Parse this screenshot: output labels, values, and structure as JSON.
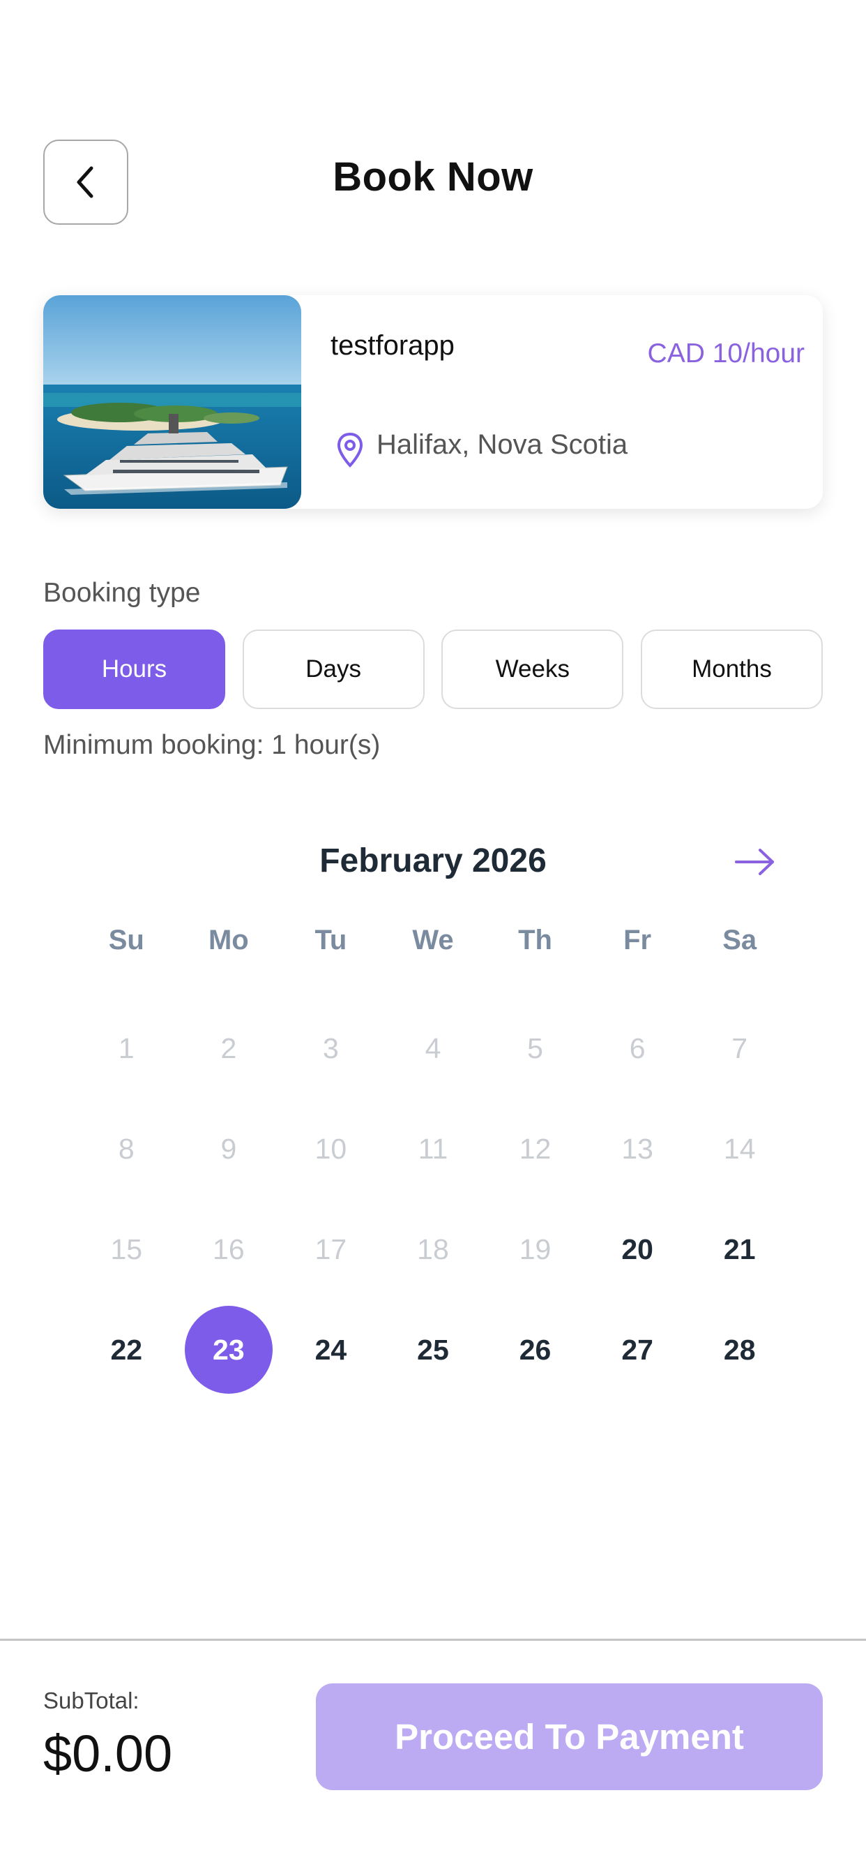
{
  "header": {
    "title": "Book Now"
  },
  "listing": {
    "name": "testforapp",
    "price": "CAD 10/hour",
    "location": "Halifax, Nova Scotia"
  },
  "booking": {
    "label": "Booking type",
    "types": [
      "Hours",
      "Days",
      "Weeks",
      "Months"
    ],
    "selected_type": "Hours",
    "minimum_text": "Minimum booking: 1 hour(s)"
  },
  "calendar": {
    "month_label": "February 2026",
    "weekdays": [
      "Su",
      "Mo",
      "Tu",
      "We",
      "Th",
      "Fr",
      "Sa"
    ],
    "days": [
      {
        "d": "1",
        "state": "disabled"
      },
      {
        "d": "2",
        "state": "disabled"
      },
      {
        "d": "3",
        "state": "disabled"
      },
      {
        "d": "4",
        "state": "disabled"
      },
      {
        "d": "5",
        "state": "disabled"
      },
      {
        "d": "6",
        "state": "disabled"
      },
      {
        "d": "7",
        "state": "disabled"
      },
      {
        "d": "8",
        "state": "disabled"
      },
      {
        "d": "9",
        "state": "disabled"
      },
      {
        "d": "10",
        "state": "disabled"
      },
      {
        "d": "11",
        "state": "disabled"
      },
      {
        "d": "12",
        "state": "disabled"
      },
      {
        "d": "13",
        "state": "disabled"
      },
      {
        "d": "14",
        "state": "disabled"
      },
      {
        "d": "15",
        "state": "disabled"
      },
      {
        "d": "16",
        "state": "disabled"
      },
      {
        "d": "17",
        "state": "disabled"
      },
      {
        "d": "18",
        "state": "disabled"
      },
      {
        "d": "19",
        "state": "disabled"
      },
      {
        "d": "20",
        "state": "available"
      },
      {
        "d": "21",
        "state": "available"
      },
      {
        "d": "22",
        "state": "available"
      },
      {
        "d": "23",
        "state": "selected"
      },
      {
        "d": "24",
        "state": "available"
      },
      {
        "d": "25",
        "state": "available"
      },
      {
        "d": "26",
        "state": "available"
      },
      {
        "d": "27",
        "state": "available"
      },
      {
        "d": "28",
        "state": "available"
      }
    ]
  },
  "footer": {
    "subtotal_label": "SubTotal:",
    "subtotal_value": "$0.00",
    "proceed_label": "Proceed To Payment"
  },
  "colors": {
    "accent": "#7c5ce8",
    "accent_disabled": "#bcaaf3",
    "price_text": "#8a62e0"
  },
  "icons": {
    "back": "chevron-left-icon",
    "location": "map-pin-icon",
    "next_month": "arrow-right-icon"
  }
}
